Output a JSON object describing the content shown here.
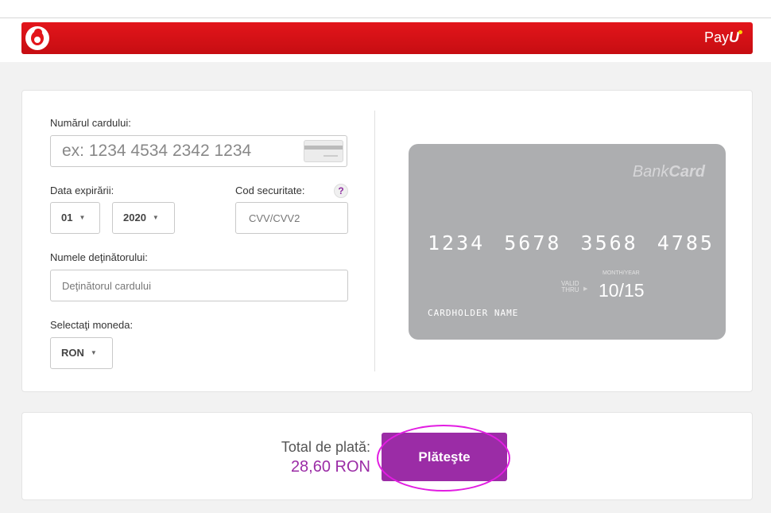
{
  "header": {
    "brand_left": "vodafone-logo",
    "brand_right_prefix": "Pay",
    "brand_right_bold": "U",
    "color_primary": "#e3151b"
  },
  "form": {
    "card_number_label": "Numărul cardului:",
    "card_number_placeholder": "ex: 1234 4534 2342 1234",
    "expiry_label": "Data expirării:",
    "expiry_month": "01",
    "expiry_year": "2020",
    "cvv_label": "Cod securitate:",
    "cvv_help": "?",
    "cvv_placeholder": "CVV/CVV2",
    "holder_label": "Numele deţinătorului:",
    "holder_placeholder": "Deţinătorul cardului",
    "currency_label": "Selectaţi moneda:",
    "currency_value": "RON"
  },
  "card_preview": {
    "brand_regular": "Bank",
    "brand_bold": "Card",
    "number": "1234 5678 3568 4785",
    "valid_line1": "VALID",
    "valid_line2": "THRU",
    "month_year_label": "MONTH/YEAR",
    "expiry": "10/15",
    "holder": "CARDHOLDER NAME"
  },
  "payment": {
    "total_label": "Total de plată:",
    "total_value": "28,60 RON",
    "pay_button": "Plăteşte",
    "accent_color": "#9b2ca6"
  }
}
